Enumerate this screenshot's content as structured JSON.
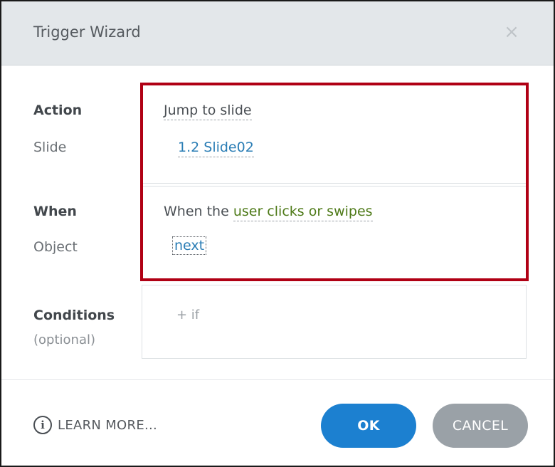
{
  "dialog": {
    "title": "Trigger Wizard",
    "close_glyph": "×"
  },
  "action": {
    "label": "Action",
    "value": "Jump to slide",
    "slide_label": "Slide",
    "slide_value": "1.2 Slide02"
  },
  "when": {
    "label": "When",
    "prefix": "When the ",
    "event": "user clicks or swipes",
    "object_label": "Object",
    "object_value": "next"
  },
  "conditions": {
    "label": "Conditions",
    "sublabel": "(optional)",
    "add_label": "+ if"
  },
  "footer": {
    "info_glyph": "i",
    "learn_more": "LEARN MORE...",
    "ok_label": "OK",
    "cancel_label": "CANCEL"
  },
  "colors": {
    "header_bg": "#e3e7ea",
    "highlight_border": "#b00014",
    "link_blue": "#2a7db5",
    "link_green": "#4e7a18",
    "ok_button": "#1c80d0",
    "cancel_button": "#9aa1a7"
  },
  "icons": {
    "close": "close-icon",
    "info": "info-icon"
  }
}
